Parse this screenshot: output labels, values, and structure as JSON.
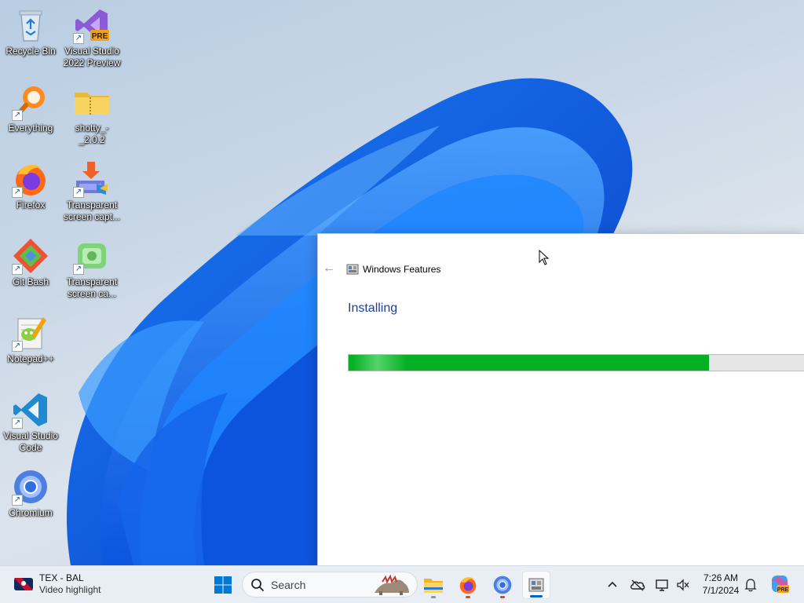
{
  "desktop": {
    "icons": [
      {
        "label": "Recycle Bin",
        "icon": "recycle-bin-icon"
      },
      {
        "label": "Visual Studio 2022 Preview",
        "icon": "visual-studio-preview-icon",
        "badge": "PRE"
      },
      {
        "label": "Everything",
        "icon": "everything-search-icon"
      },
      {
        "label": "shotty_-_2.0.2",
        "icon": "zip-folder-icon"
      },
      {
        "label": "Firefox",
        "icon": "firefox-icon"
      },
      {
        "label": "Transparent screen capt...",
        "icon": "installer-icon"
      },
      {
        "label": "Git Bash",
        "icon": "git-bash-icon"
      },
      {
        "label": "Transparent screen ca...",
        "icon": "green-app-icon"
      },
      {
        "label": "Notepad++",
        "icon": "notepad-plus-plus-icon"
      },
      {
        "label": "Visual Studio Code",
        "icon": "vscode-icon"
      },
      {
        "label": "Chromium",
        "icon": "chromium-icon"
      }
    ]
  },
  "dialog": {
    "title": "Windows Features",
    "heading": "Installing",
    "progress": 0.79,
    "colors": {
      "progress_fill": "#06b025",
      "heading": "#1e3f94"
    }
  },
  "taskbar": {
    "weather": {
      "line1": "TEX - BAL",
      "line2": "Video highlight"
    },
    "search": {
      "placeholder": "Search"
    },
    "pinned": [
      "windows-start-icon",
      "file-explorer-icon",
      "firefox-icon",
      "chromium-icon",
      "windows-features-icon"
    ],
    "tray": [
      "chevron-up-icon",
      "onedrive-off-icon",
      "display-network-icon",
      "volume-muted-icon"
    ],
    "clock": {
      "time": "7:26 AM",
      "date": "7/1/2024"
    },
    "copilot_badge": "PRE"
  }
}
